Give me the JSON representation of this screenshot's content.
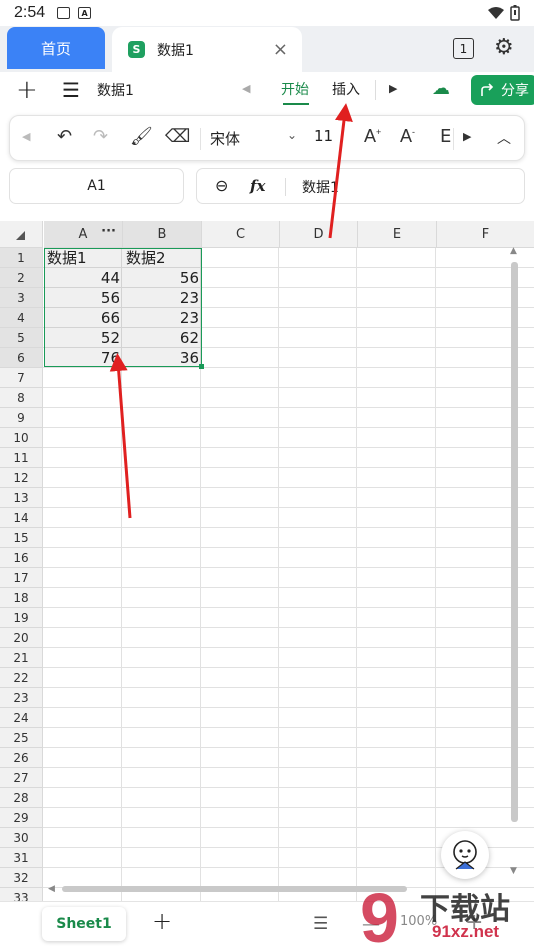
{
  "status_bar": {
    "time": "2:54",
    "icon_a_label": "A"
  },
  "tabs": {
    "home_label": "首页",
    "doc_badge": "S",
    "doc_title": "数据1",
    "close_icon": "×",
    "tab_count": "1"
  },
  "menu_bar": {
    "file_title": "数据1",
    "tab_start": "开始",
    "tab_insert": "插入",
    "share_label": "分享",
    "accent_color": "#1a8a4a"
  },
  "toolbar": {
    "font_name": "宋体",
    "font_size": "11"
  },
  "formula_bar": {
    "cell_ref": "A1",
    "fx_label": "fx",
    "value": "数据1"
  },
  "grid": {
    "columns": [
      "A",
      "B",
      "C",
      "D",
      "E",
      "F"
    ],
    "rows": [
      "1",
      "2",
      "3",
      "4",
      "5",
      "6",
      "7",
      "8",
      "9",
      "10",
      "11",
      "12",
      "13",
      "14",
      "15",
      "16",
      "17",
      "18",
      "19",
      "20",
      "21",
      "22",
      "23",
      "24",
      "25",
      "26",
      "27",
      "28",
      "29",
      "30",
      "31",
      "32",
      "33"
    ],
    "cells": [
      [
        "数据1",
        "数据2"
      ],
      [
        "44",
        "56"
      ],
      [
        "56",
        "23"
      ],
      [
        "66",
        "23"
      ],
      [
        "52",
        "62"
      ],
      [
        "76",
        "36"
      ]
    ],
    "selection_color": "#1a9a58"
  },
  "sheet_tabs": {
    "active_tab": "Sheet1",
    "zoom": "100%"
  },
  "watermark": {
    "text": "下载站",
    "url": "91xz.net"
  }
}
